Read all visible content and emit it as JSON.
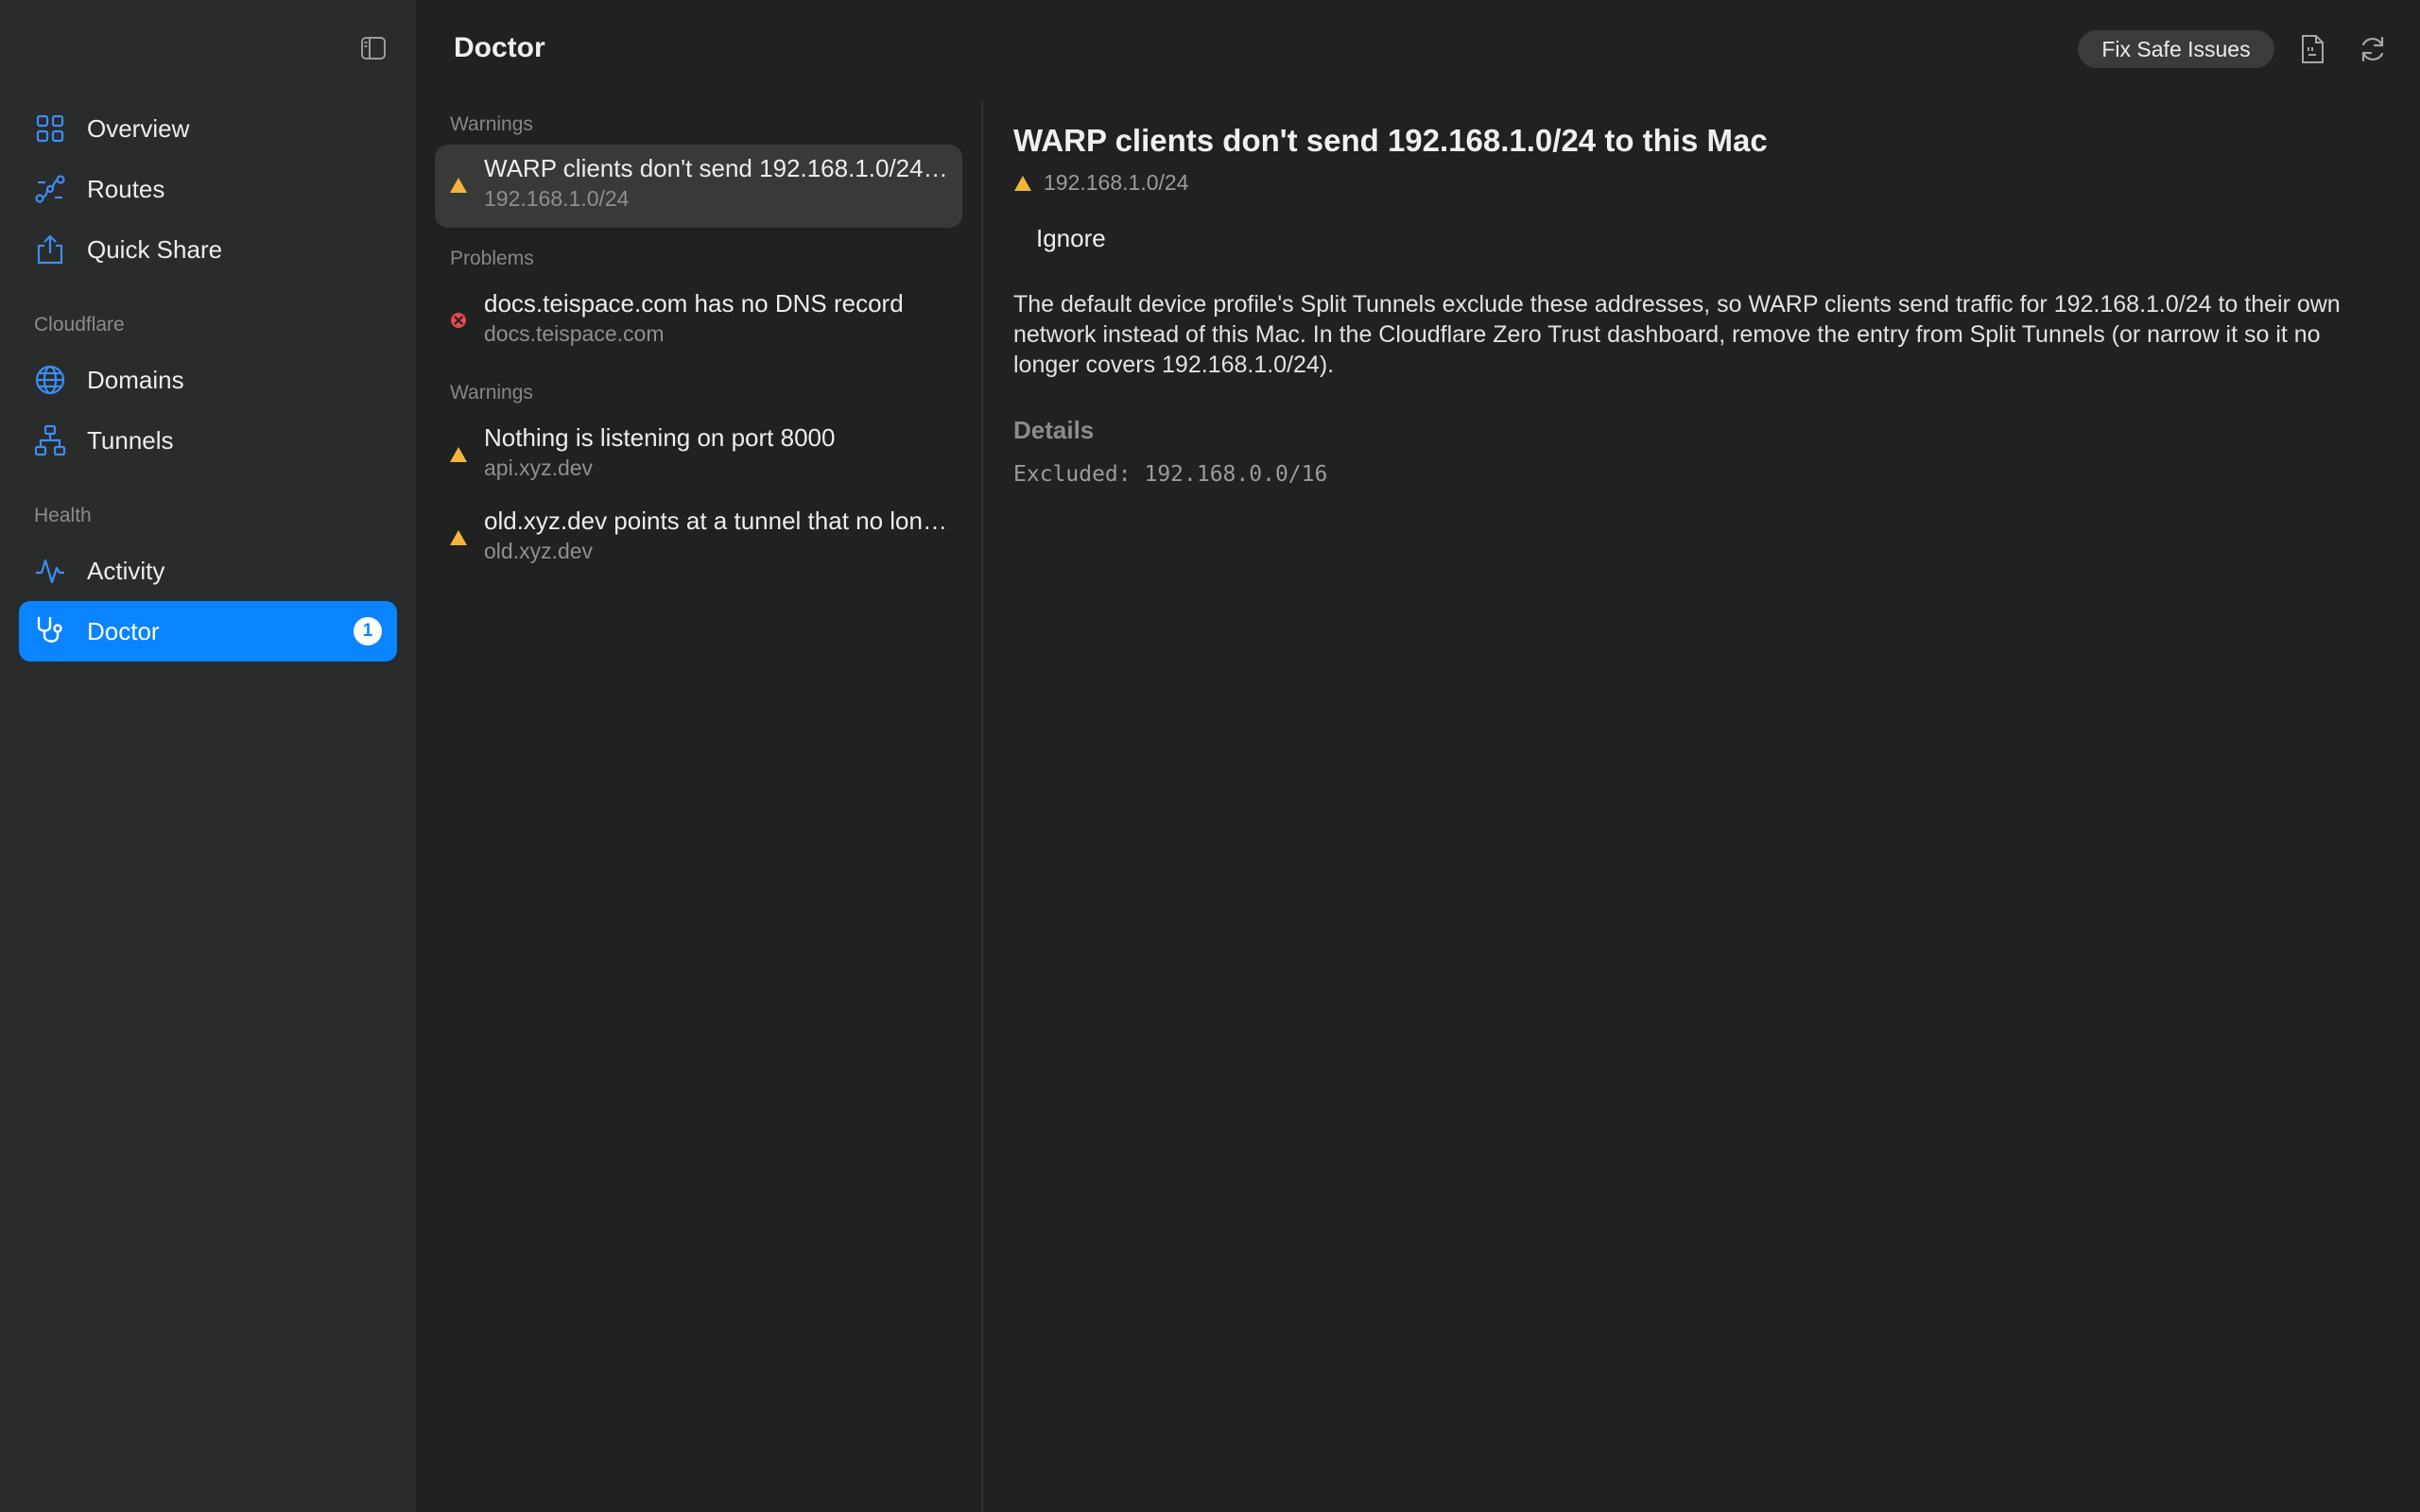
{
  "sidebar": {
    "items_top": [
      {
        "label": "Overview",
        "icon": "grid-icon"
      },
      {
        "label": "Routes",
        "icon": "routes-icon"
      },
      {
        "label": "Quick Share",
        "icon": "share-icon"
      }
    ],
    "sections": [
      {
        "title": "Cloudflare",
        "items": [
          {
            "label": "Domains",
            "icon": "globe-icon"
          },
          {
            "label": "Tunnels",
            "icon": "network-icon"
          }
        ]
      },
      {
        "title": "Health",
        "items": [
          {
            "label": "Activity",
            "icon": "activity-icon"
          },
          {
            "label": "Doctor",
            "icon": "stethoscope-icon",
            "active": true,
            "badge": "1"
          }
        ]
      }
    ]
  },
  "header": {
    "title": "Doctor",
    "fix_button": "Fix Safe Issues"
  },
  "list": {
    "groups": [
      {
        "title": "Warnings",
        "issues": [
          {
            "title": "WARP clients don't send 192.168.1.0/24 to this Mac",
            "subtitle": "192.168.1.0/24",
            "severity": "warning",
            "selected": true
          }
        ]
      },
      {
        "title": "Problems",
        "issues": [
          {
            "title": "docs.teispace.com has no DNS record",
            "subtitle": "docs.teispace.com",
            "severity": "error"
          }
        ]
      },
      {
        "title": "Warnings",
        "issues": [
          {
            "title": "Nothing is listening on port 8000",
            "subtitle": "api.xyz.dev",
            "severity": "warning"
          },
          {
            "title": "old.xyz.dev points at a tunnel that no longer exists",
            "subtitle": "old.xyz.dev",
            "severity": "warning"
          }
        ]
      }
    ]
  },
  "detail": {
    "title": "WARP clients don't send 192.168.1.0/24 to this Mac",
    "subtitle": "192.168.1.0/24",
    "ignore_label": "Ignore",
    "description": "The default device profile's Split Tunnels exclude these addresses, so WARP clients send traffic for 192.168.1.0/24 to their own network instead of this Mac. In the Cloudflare Zero Trust dashboard, remove the entry from Split Tunnels (or narrow it so it no longer covers 192.168.1.0/24).",
    "details_header": "Details",
    "details_text": "Excluded: 192.168.0.0/16"
  },
  "colors": {
    "accent": "#0a84ff",
    "warning": "#f5b43a",
    "error": "#e5484d",
    "icon_blue": "#3b8ef5"
  }
}
